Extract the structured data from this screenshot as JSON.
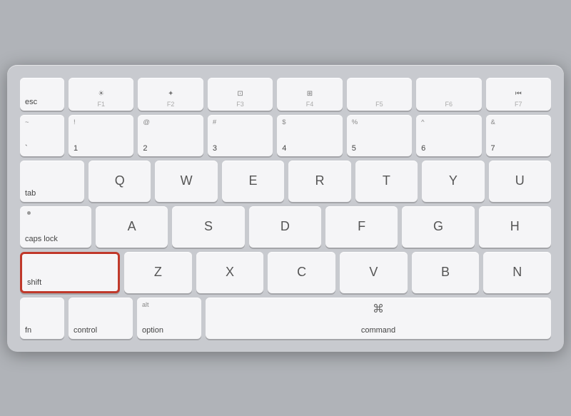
{
  "keyboard": {
    "rows": {
      "fn_row": {
        "esc": "esc",
        "f1": "F1",
        "f2": "F2",
        "f3": "F3",
        "f4": "F4",
        "f5": "F5",
        "f6": "F6",
        "f7": "F7"
      },
      "number_row": {
        "backtick": {
          "top": "~",
          "bottom": "`"
        },
        "1": {
          "top": "!",
          "bottom": "1"
        },
        "2": {
          "top": "@",
          "bottom": "2"
        },
        "3": {
          "top": "#",
          "bottom": "3"
        },
        "4": {
          "top": "$",
          "bottom": "4"
        },
        "5": {
          "top": "%",
          "bottom": "5"
        },
        "6": {
          "top": "^",
          "bottom": "6"
        },
        "7": {
          "top": "&",
          "bottom": "7"
        }
      },
      "qwerty_row": {
        "tab": "tab",
        "letters": [
          "Q",
          "W",
          "E",
          "R",
          "T",
          "Y",
          "U"
        ]
      },
      "asdf_row": {
        "caps": "caps lock",
        "letters": [
          "A",
          "S",
          "D",
          "F",
          "G",
          "H"
        ]
      },
      "zxcv_row": {
        "shift": "shift",
        "letters": [
          "Z",
          "X",
          "C",
          "V",
          "B",
          "N"
        ]
      },
      "bottom_row": {
        "fn": "fn",
        "control": "control",
        "option_top": "alt",
        "option_bottom": "option",
        "command_top": "⌘",
        "command_bottom": "command"
      }
    }
  }
}
